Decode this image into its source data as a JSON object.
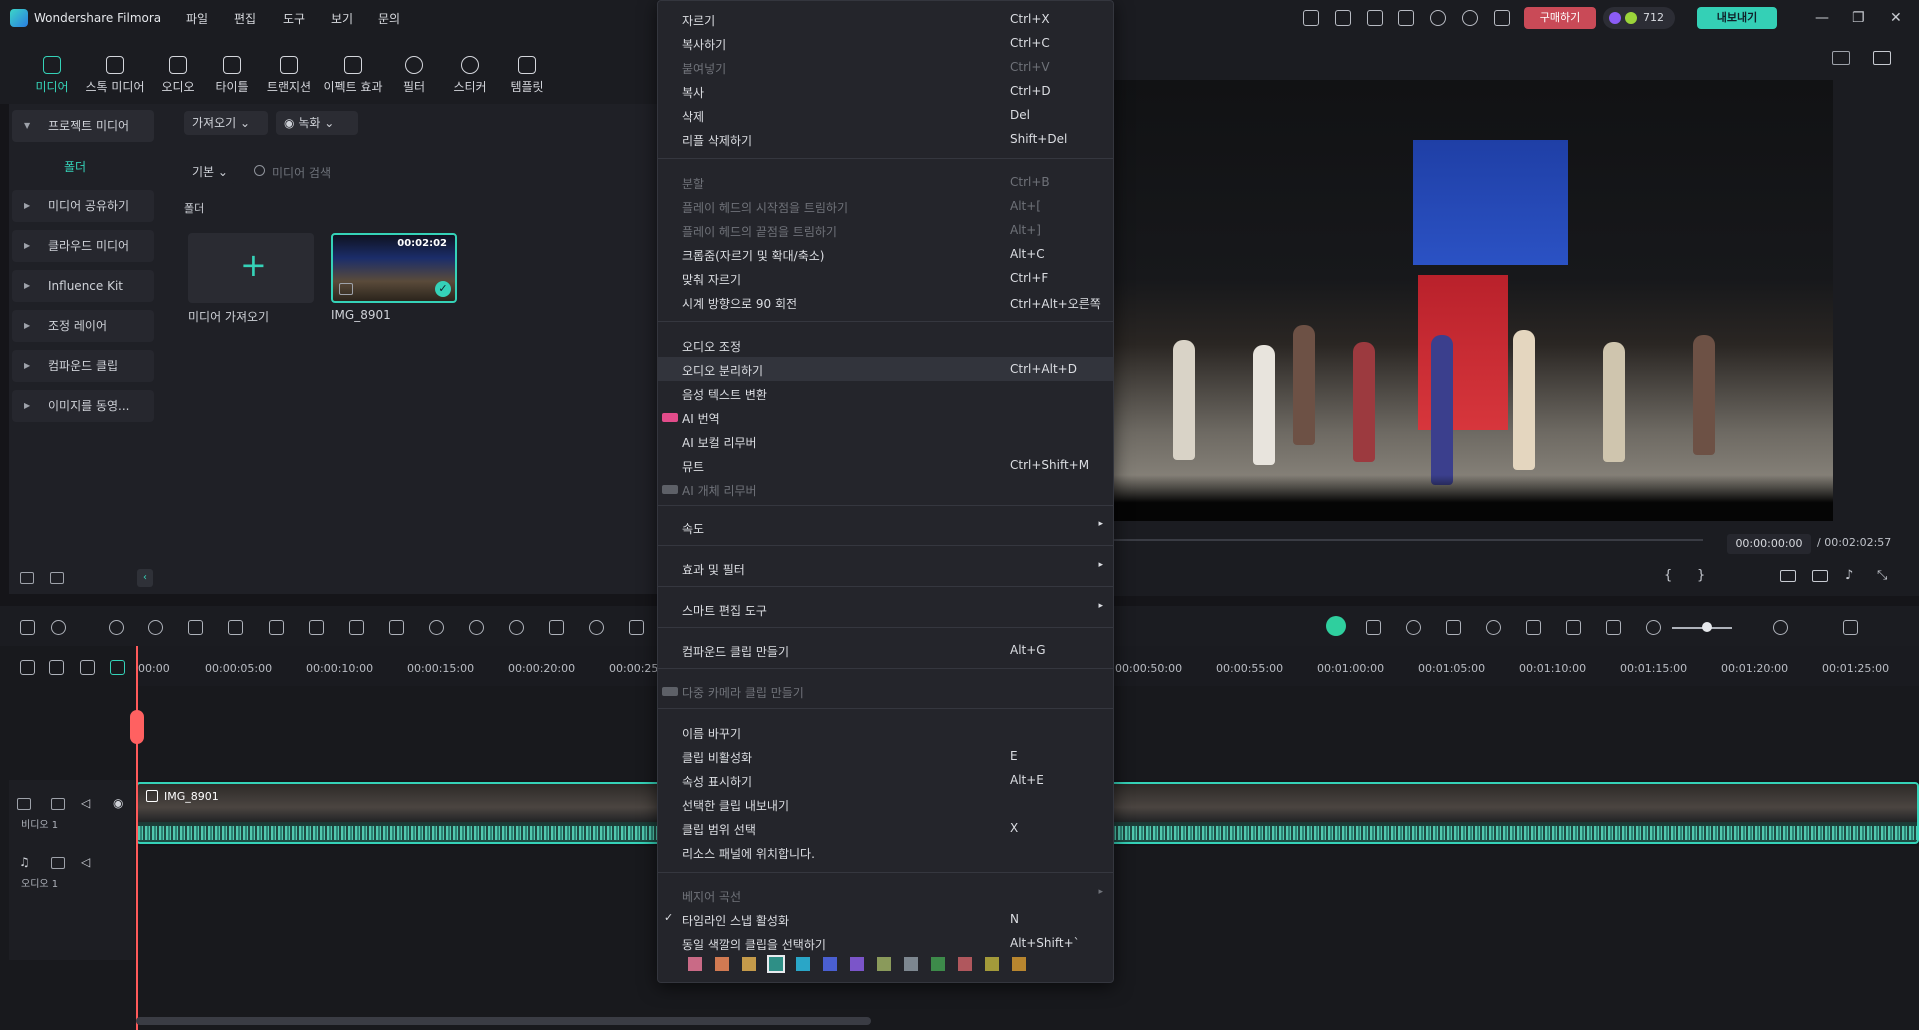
{
  "app": {
    "title": "Wondershare Filmora"
  },
  "menubar": [
    "파일",
    "편집",
    "도구",
    "보기",
    "문의"
  ],
  "titlebar": {
    "buy_label": "구매하기",
    "credits": "712",
    "export_label": "내보내기"
  },
  "media_tabs": [
    "미디어",
    "스톡 미디어",
    "오디오",
    "타이틀",
    "트랜지션",
    "이펙트 효과",
    "필터",
    "스티커",
    "템플릿"
  ],
  "side_nav": {
    "project_media": "프로젝트 미디어",
    "folder": "폴더",
    "items": [
      "미디어 공유하기",
      "클라우드 미디어",
      "Influence Kit",
      "조정 레이어",
      "컴파운드 클립",
      "이미지를 동영..."
    ]
  },
  "media_panel": {
    "import_dropdown": "가져오기",
    "record_dropdown": "녹화",
    "sort_dropdown": "기본",
    "search_placeholder": "미디어 검색",
    "folder_title": "폴더",
    "import_tile_label": "미디어 가져오기",
    "clip": {
      "name": "IMG_8901",
      "duration": "00:02:02"
    }
  },
  "preview": {
    "current_time": "00:00:00:00",
    "total_time": "/ 00:02:02:57"
  },
  "timeline": {
    "ruler_labels": [
      "00:00",
      "00:00:05:00",
      "00:00:10:00",
      "00:00:15:00",
      "00:00:20:00",
      "00:00:25",
      "00:00:50:00",
      "00:00:55:00",
      "00:01:00:00",
      "00:01:05:00",
      "00:01:10:00",
      "00:01:15:00",
      "00:01:20:00",
      "00:01:25:00"
    ],
    "video_track_label": "비디오 1",
    "audio_track_label": "오디오 1",
    "clip_name": "IMG_8901"
  },
  "context_menu": {
    "items": [
      {
        "label": "자르기",
        "shortcut": "Ctrl+X",
        "state": "normal"
      },
      {
        "label": "복사하기",
        "shortcut": "Ctrl+C",
        "state": "normal"
      },
      {
        "label": "붙여넣기",
        "shortcut": "Ctrl+V",
        "state": "disabled"
      },
      {
        "label": "복사",
        "shortcut": "Ctrl+D",
        "state": "normal"
      },
      {
        "label": "삭제",
        "shortcut": "Del",
        "state": "normal"
      },
      {
        "label": "리플 삭제하기",
        "shortcut": "Shift+Del",
        "state": "normal"
      },
      {
        "label": "분할",
        "shortcut": "Ctrl+B",
        "state": "disabled"
      },
      {
        "label": "플레이 헤드의 시작점을 트림하기",
        "shortcut": "Alt+[",
        "state": "disabled"
      },
      {
        "label": "플레이 헤드의 끝점을 트림하기",
        "shortcut": "Alt+]",
        "state": "disabled"
      },
      {
        "label": "크롭줌(자르기 및 확대/축소)",
        "shortcut": "Alt+C",
        "state": "normal"
      },
      {
        "label": "맞춰 자르기",
        "shortcut": "Ctrl+F",
        "state": "normal"
      },
      {
        "label": "시계 방향으로 90 회전",
        "shortcut": "Ctrl+Alt+오른쪽",
        "state": "normal"
      },
      {
        "label": "오디오 조정",
        "shortcut": "",
        "state": "normal"
      },
      {
        "label": "오디오 분리하기",
        "shortcut": "Ctrl+Alt+D",
        "state": "hover"
      },
      {
        "label": "음성 텍스트 변환",
        "shortcut": "",
        "state": "normal"
      },
      {
        "label": "AI 번역",
        "shortcut": "",
        "state": "new"
      },
      {
        "label": "AI 보컬 리무버",
        "shortcut": "",
        "state": "normal"
      },
      {
        "label": "뮤트",
        "shortcut": "Ctrl+Shift+M",
        "state": "normal"
      },
      {
        "label": "AI 개체 리무버",
        "shortcut": "",
        "state": "disabled-new"
      },
      {
        "label": "속도",
        "shortcut": "",
        "state": "submenu"
      },
      {
        "label": "효과 및 필터",
        "shortcut": "",
        "state": "submenu"
      },
      {
        "label": "스마트 편집 도구",
        "shortcut": "",
        "state": "submenu"
      },
      {
        "label": "컴파운드 클립 만들기",
        "shortcut": "Alt+G",
        "state": "normal"
      },
      {
        "label": "다중 카메라 클립 만들기",
        "shortcut": "",
        "state": "disabled-new"
      },
      {
        "label": "이름 바꾸기",
        "shortcut": "",
        "state": "normal"
      },
      {
        "label": "클립 비활성화",
        "shortcut": "E",
        "state": "normal"
      },
      {
        "label": "속성 표시하기",
        "shortcut": "Alt+E",
        "state": "normal"
      },
      {
        "label": "선택한 클립 내보내기",
        "shortcut": "",
        "state": "normal"
      },
      {
        "label": "클립 범위 선택",
        "shortcut": "X",
        "state": "normal"
      },
      {
        "label": "리소스 패널에 위치합니다.",
        "shortcut": "",
        "state": "normal"
      },
      {
        "label": "베지어 곡선",
        "shortcut": "",
        "state": "disabled-submenu"
      },
      {
        "label": "타임라인 스냅 활성화",
        "shortcut": "N",
        "state": "checked"
      },
      {
        "label": "동일 색깔의 클립을 선택하기",
        "shortcut": "Alt+Shift+`",
        "state": "normal"
      }
    ],
    "swatches": [
      "#c96a86",
      "#d17a52",
      "#c49a4a",
      "#2e8f86",
      "#2aa6c7",
      "#4a5fd1",
      "#7b55c9",
      "#8a9a5b",
      "#7d8790",
      "#3d8a4a",
      "#b0575d",
      "#a39a3a",
      "#b8862f"
    ]
  },
  "colors": {
    "accent": "#35d2b8",
    "buy": "#c94a57",
    "playhead": "#ff5a5a"
  }
}
